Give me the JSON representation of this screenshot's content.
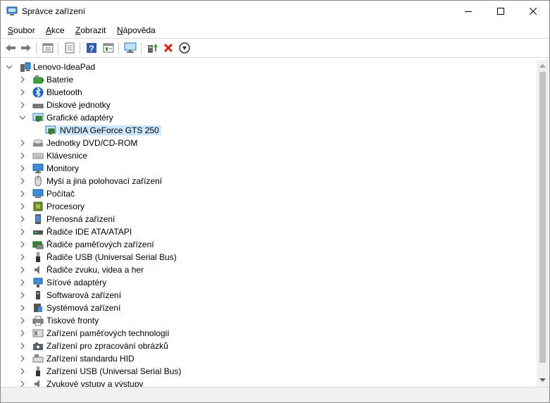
{
  "window": {
    "title": "Správce zařízení"
  },
  "menu": [
    {
      "label": "Soubor"
    },
    {
      "label": "Akce"
    },
    {
      "label": "Zobrazit"
    },
    {
      "label": "Nápověda"
    }
  ],
  "toolbar": {
    "icons": [
      "back-arrow-icon",
      "forward-arrow-icon",
      "properties-icon",
      "scan-icon",
      "help-icon",
      "view-icon",
      "monitor-icon",
      "update-driver-icon",
      "uninstall-icon",
      "download-icon"
    ]
  },
  "tree": {
    "root": "Lenovo-IdeaPad",
    "items": [
      {
        "label": "Baterie",
        "icon": "battery-icon",
        "expanded": false
      },
      {
        "label": "Bluetooth",
        "icon": "bluetooth-icon",
        "expanded": false
      },
      {
        "label": "Diskové jednotky",
        "icon": "disk-drive-icon",
        "expanded": false
      },
      {
        "label": "Grafické adaptéry",
        "icon": "display-adapter-icon",
        "expanded": true,
        "children": [
          {
            "label": "NVIDIA GeForce GTS 250",
            "icon": "display-adapter-icon",
            "selected": true
          }
        ]
      },
      {
        "label": "Jednotky DVD/CD-ROM",
        "icon": "dvd-drive-icon",
        "expanded": false
      },
      {
        "label": "Klávesnice",
        "icon": "keyboard-icon",
        "expanded": false
      },
      {
        "label": "Monitory",
        "icon": "monitor-icon",
        "expanded": false
      },
      {
        "label": "Myši a jiná polohovací zařízení",
        "icon": "mouse-icon",
        "expanded": false
      },
      {
        "label": "Počítač",
        "icon": "computer-icon",
        "expanded": false
      },
      {
        "label": "Procesory",
        "icon": "processor-icon",
        "expanded": false
      },
      {
        "label": "Přenosná zařízení",
        "icon": "portable-device-icon",
        "expanded": false
      },
      {
        "label": "Řadiče IDE ATA/ATAPI",
        "icon": "ide-controller-icon",
        "expanded": false
      },
      {
        "label": "Řadiče paměťových zařízení",
        "icon": "storage-controller-icon",
        "expanded": false
      },
      {
        "label": "Řadiče USB (Universal Serial Bus)",
        "icon": "usb-icon",
        "expanded": false
      },
      {
        "label": "Řadiče zvuku, videa a her",
        "icon": "speaker-icon",
        "expanded": false
      },
      {
        "label": "Síťové adaptéry",
        "icon": "network-adapter-icon",
        "expanded": false
      },
      {
        "label": "Softwarová zařízení",
        "icon": "software-device-icon",
        "expanded": false
      },
      {
        "label": "Systémová zařízení",
        "icon": "system-device-icon",
        "expanded": false
      },
      {
        "label": "Tiskové fronty",
        "icon": "printer-icon",
        "expanded": false
      },
      {
        "label": "Zařízení paměťových technologií",
        "icon": "memory-tech-icon",
        "expanded": false
      },
      {
        "label": "Zařízení pro zpracování obrázků",
        "icon": "camera-icon",
        "expanded": false
      },
      {
        "label": "Zařízení standardu HID",
        "icon": "hid-icon",
        "expanded": false
      },
      {
        "label": "Zařízení USB (Universal Serial Bus)",
        "icon": "usb-icon",
        "expanded": false
      },
      {
        "label": "Zvukové vstupy a výstupy",
        "icon": "speaker-icon",
        "expanded": false
      }
    ]
  },
  "colors": {
    "selection": "#cce8ff",
    "help_blue": "#2b5fb4",
    "uninstall_red": "#e21b1b"
  }
}
